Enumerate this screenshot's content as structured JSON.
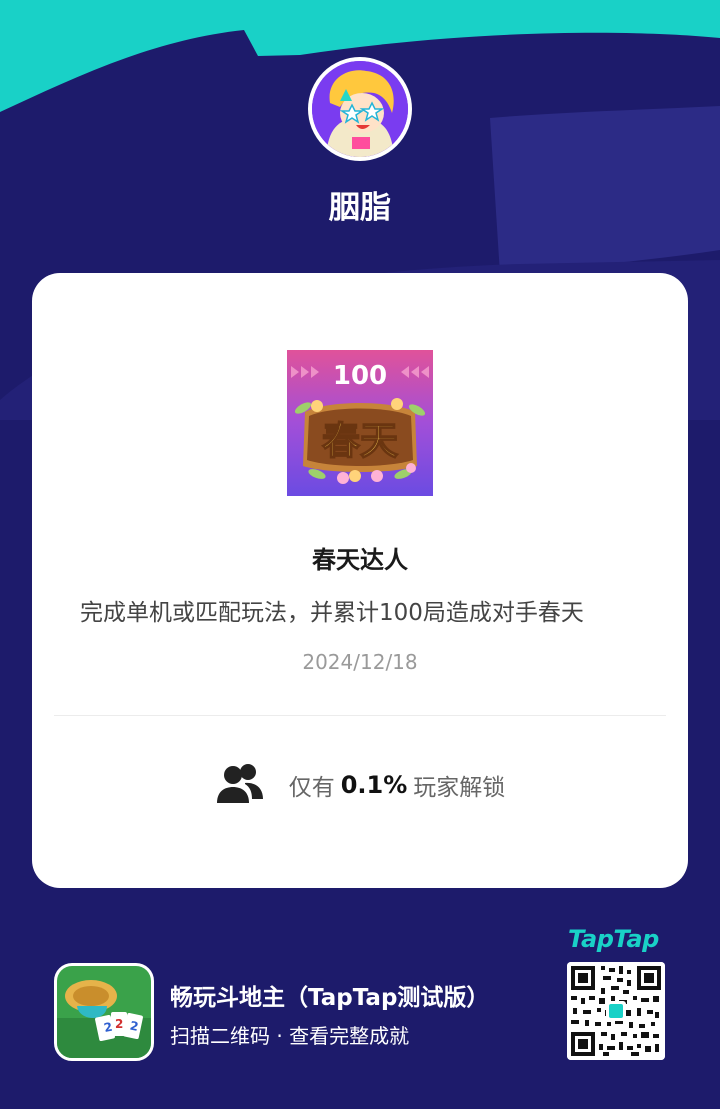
{
  "profile": {
    "username": "胭脂"
  },
  "achievement": {
    "badge_number": "100",
    "badge_text": "春天",
    "title": "春天达人",
    "description": "完成单机或匹配玩法，并累计100局造成对手春天",
    "date": "2024/12/18",
    "unlock_prefix": "仅有",
    "unlock_percent": "0.1%",
    "unlock_suffix": "玩家解锁"
  },
  "footer": {
    "game_title": "畅玩斗地主（TapTap测试版）",
    "game_subtitle": "扫描二维码 · 查看完整成就",
    "brand": "TapTap"
  },
  "colors": {
    "background": "#1d1b6b",
    "accent_teal": "#19d1c7",
    "card": "#ffffff"
  },
  "icons": [
    "avatar",
    "achievement-badge",
    "people-icon",
    "game-app-icon",
    "qr-code"
  ]
}
